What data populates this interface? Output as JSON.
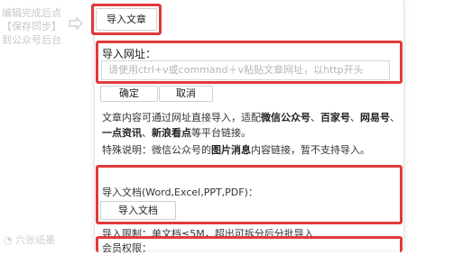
{
  "left_hint": {
    "line1": "编辑完成后点",
    "line2": "【保存同步】",
    "line3": "到公众号后台"
  },
  "import_article_label": "导入文章",
  "url_section": {
    "label": "导入网址：",
    "placeholder": "请使用ctrl+v或command＋v粘贴文章网址，以http开头",
    "confirm_label": "确定",
    "cancel_label": "取消"
  },
  "desc": {
    "l1_a": "文章内容可通过网址直接导入，适配",
    "l1_b": "微信公众号",
    "l1_c": "、",
    "l1_d": "百家号",
    "l1_e": "、",
    "l1_f": "网易号",
    "l1_g": "、",
    "l2_a": "一点资讯",
    "l2_b": "、",
    "l2_c": "新浪看点",
    "l2_d": "等平台链接。",
    "l3_a": "特殊说明：微信公众号的",
    "l3_b": "图片消息",
    "l3_c": "内容链接，暂不支持导入。"
  },
  "doc_section": {
    "label": "导入文档(Word,Excel,PPT,PDF)：",
    "button_label": "导入文档",
    "limit": "导入限制：单文档≤5M，超出可拆分后分批导入"
  },
  "cutoff_text": "会员权限：",
  "watermark": "六张纸墨",
  "colors": {
    "highlight": "#e03a3a",
    "hint": "#c8c8c8"
  }
}
